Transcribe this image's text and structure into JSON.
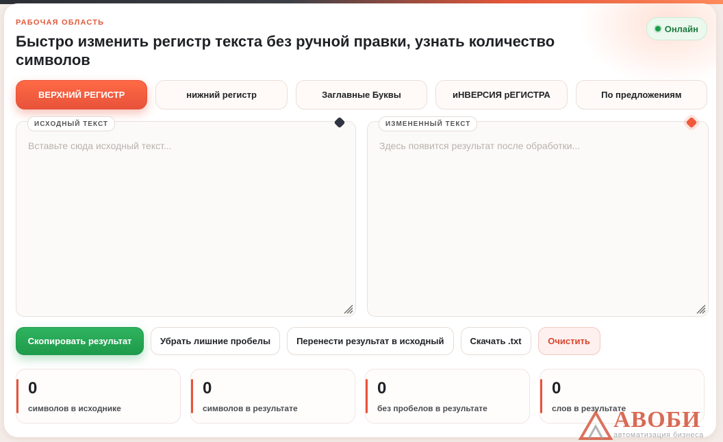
{
  "header": {
    "eyebrow": "РАБОЧАЯ ОБЛАСТЬ",
    "title": "Быстро изменить регистр текста без ручной правки, узнать количество символов",
    "status": "Онлайн"
  },
  "modes": [
    {
      "label": "ВЕРХНИЙ РЕГИСТР",
      "active": true
    },
    {
      "label": "нижний регистр",
      "active": false
    },
    {
      "label": "Заглавные Буквы",
      "active": false
    },
    {
      "label": "иНВЕРСИЯ рЕГИСТРА",
      "active": false
    },
    {
      "label": "По предложениям",
      "active": false
    }
  ],
  "source": {
    "label": "ИСХОДНЫЙ ТЕКСТ",
    "placeholder": "Вставьте сюда исходный текст..."
  },
  "result": {
    "label": "ИЗМЕНЕННЫЙ ТЕКСТ",
    "placeholder": "Здесь появится результат после обработки..."
  },
  "actions": {
    "copy": "Скопировать результат",
    "trim": "Убрать лишние пробелы",
    "move": "Перенести результат в исходный",
    "download": "Скачать .txt",
    "clear": "Очистить"
  },
  "stats": [
    {
      "value": "0",
      "label": "символов в исходнике"
    },
    {
      "value": "0",
      "label": "символов в результате"
    },
    {
      "value": "0",
      "label": "без пробелов в результате"
    },
    {
      "value": "0",
      "label": "слов в результате"
    }
  ],
  "watermark": {
    "word": "АВОБИ",
    "tagline": "автоматизация бизнеса"
  },
  "colors": {
    "accent": "#e8523a",
    "success": "#1e9a4b"
  }
}
